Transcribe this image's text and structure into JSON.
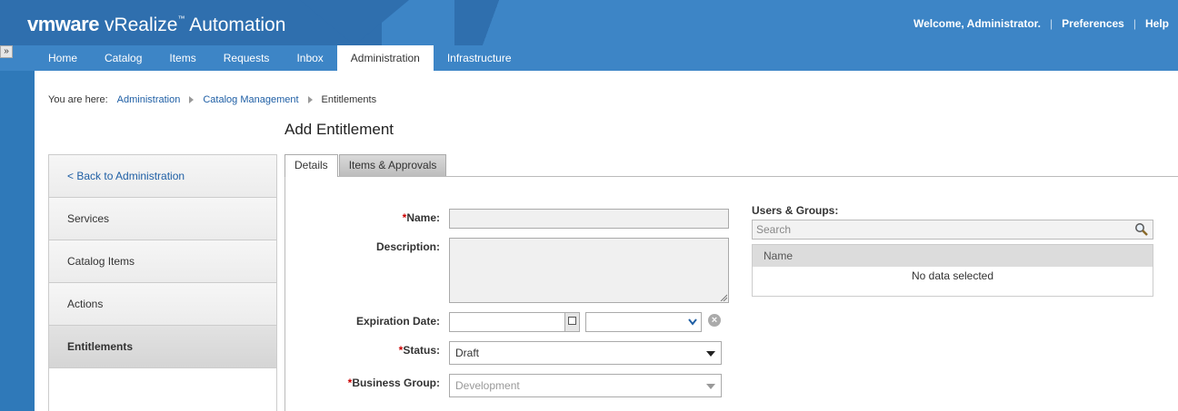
{
  "header": {
    "brand_vm": "vmware",
    "brand_product": "vRealize",
    "brand_tm": "™",
    "brand_suffix": "Automation",
    "welcome": "Welcome, Administrator.",
    "preferences": "Preferences",
    "help": "Help"
  },
  "sidebar_toggle": "»",
  "nav": {
    "tabs": [
      "Home",
      "Catalog",
      "Items",
      "Requests",
      "Inbox",
      "Administration",
      "Infrastructure"
    ],
    "active": "Administration"
  },
  "breadcrumb": {
    "prefix": "You are here:",
    "items": [
      "Administration",
      "Catalog Management",
      "Entitlements"
    ]
  },
  "page_title": "Add Entitlement",
  "left_menu": {
    "items": [
      "< Back to Administration",
      "Services",
      "Catalog Items",
      "Actions",
      "Entitlements"
    ],
    "active": "Entitlements"
  },
  "tabs": {
    "items": [
      "Details",
      "Items & Approvals"
    ],
    "active": "Details"
  },
  "form": {
    "required_mark": "*",
    "name_label": "Name:",
    "name_value": "",
    "description_label": "Description:",
    "description_value": "",
    "expiration_label": "Expiration Date:",
    "expiration_date": "",
    "expiration_time": "",
    "status_label": "Status:",
    "status_value": "Draft",
    "business_group_label": "Business Group:",
    "business_group_value": "Development"
  },
  "users_groups": {
    "label": "Users & Groups:",
    "search_placeholder": "Search",
    "column_name": "Name",
    "empty_text": "No data selected"
  },
  "colors": {
    "header_blue": "#3d85c6",
    "link_blue": "#1f5fa5",
    "required_red": "#cc0000"
  }
}
